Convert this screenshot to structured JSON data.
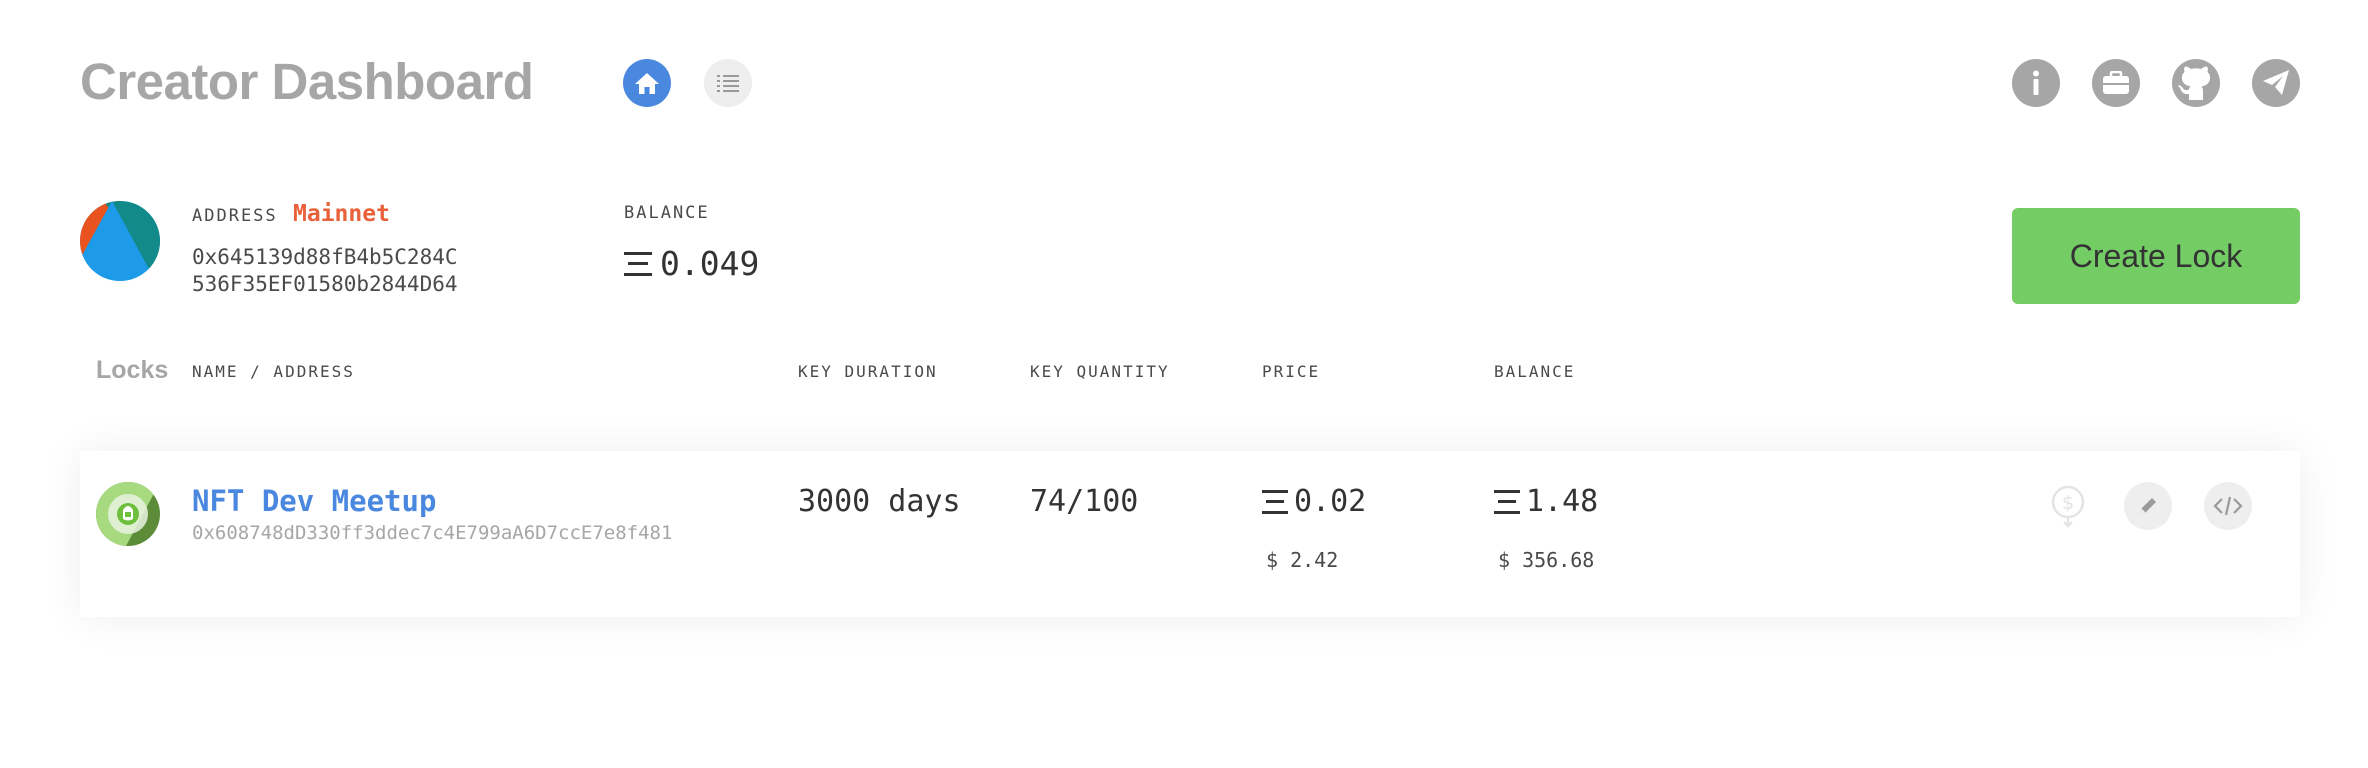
{
  "header": {
    "title": "Creator Dashboard",
    "nav": [
      {
        "icon": "home-icon",
        "active": true
      },
      {
        "icon": "list-icon",
        "active": false
      }
    ],
    "icons": [
      "info-icon",
      "briefcase-icon",
      "github-icon",
      "telegram-icon"
    ]
  },
  "account": {
    "address_label": "ADDRESS",
    "network": "Mainnet",
    "address_line1": "0x645139d88fB4b5C284C",
    "address_line2": "536F35EF01580b2844D64",
    "balance_label": "BALANCE",
    "balance_value": "0.049"
  },
  "create_button": "Create Lock",
  "table": {
    "locks_label": "Locks",
    "columns": [
      "NAME / ADDRESS",
      "KEY DURATION",
      "KEY QUANTITY",
      "PRICE",
      "BALANCE"
    ]
  },
  "locks": [
    {
      "name": "NFT Dev Meetup",
      "address": "0x608748dD330ff3ddec7c4E799aA6D7ccE7e8f481",
      "duration": "3000 days",
      "quantity": "74/100",
      "price": "0.02",
      "price_usd": "$ 2.42",
      "balance": "1.48",
      "balance_usd": "$ 356.68"
    }
  ],
  "colors": {
    "accent": "#4a88e0",
    "network": "#e8613a",
    "create": "#74cc65",
    "muted": "#a6a6a6"
  }
}
